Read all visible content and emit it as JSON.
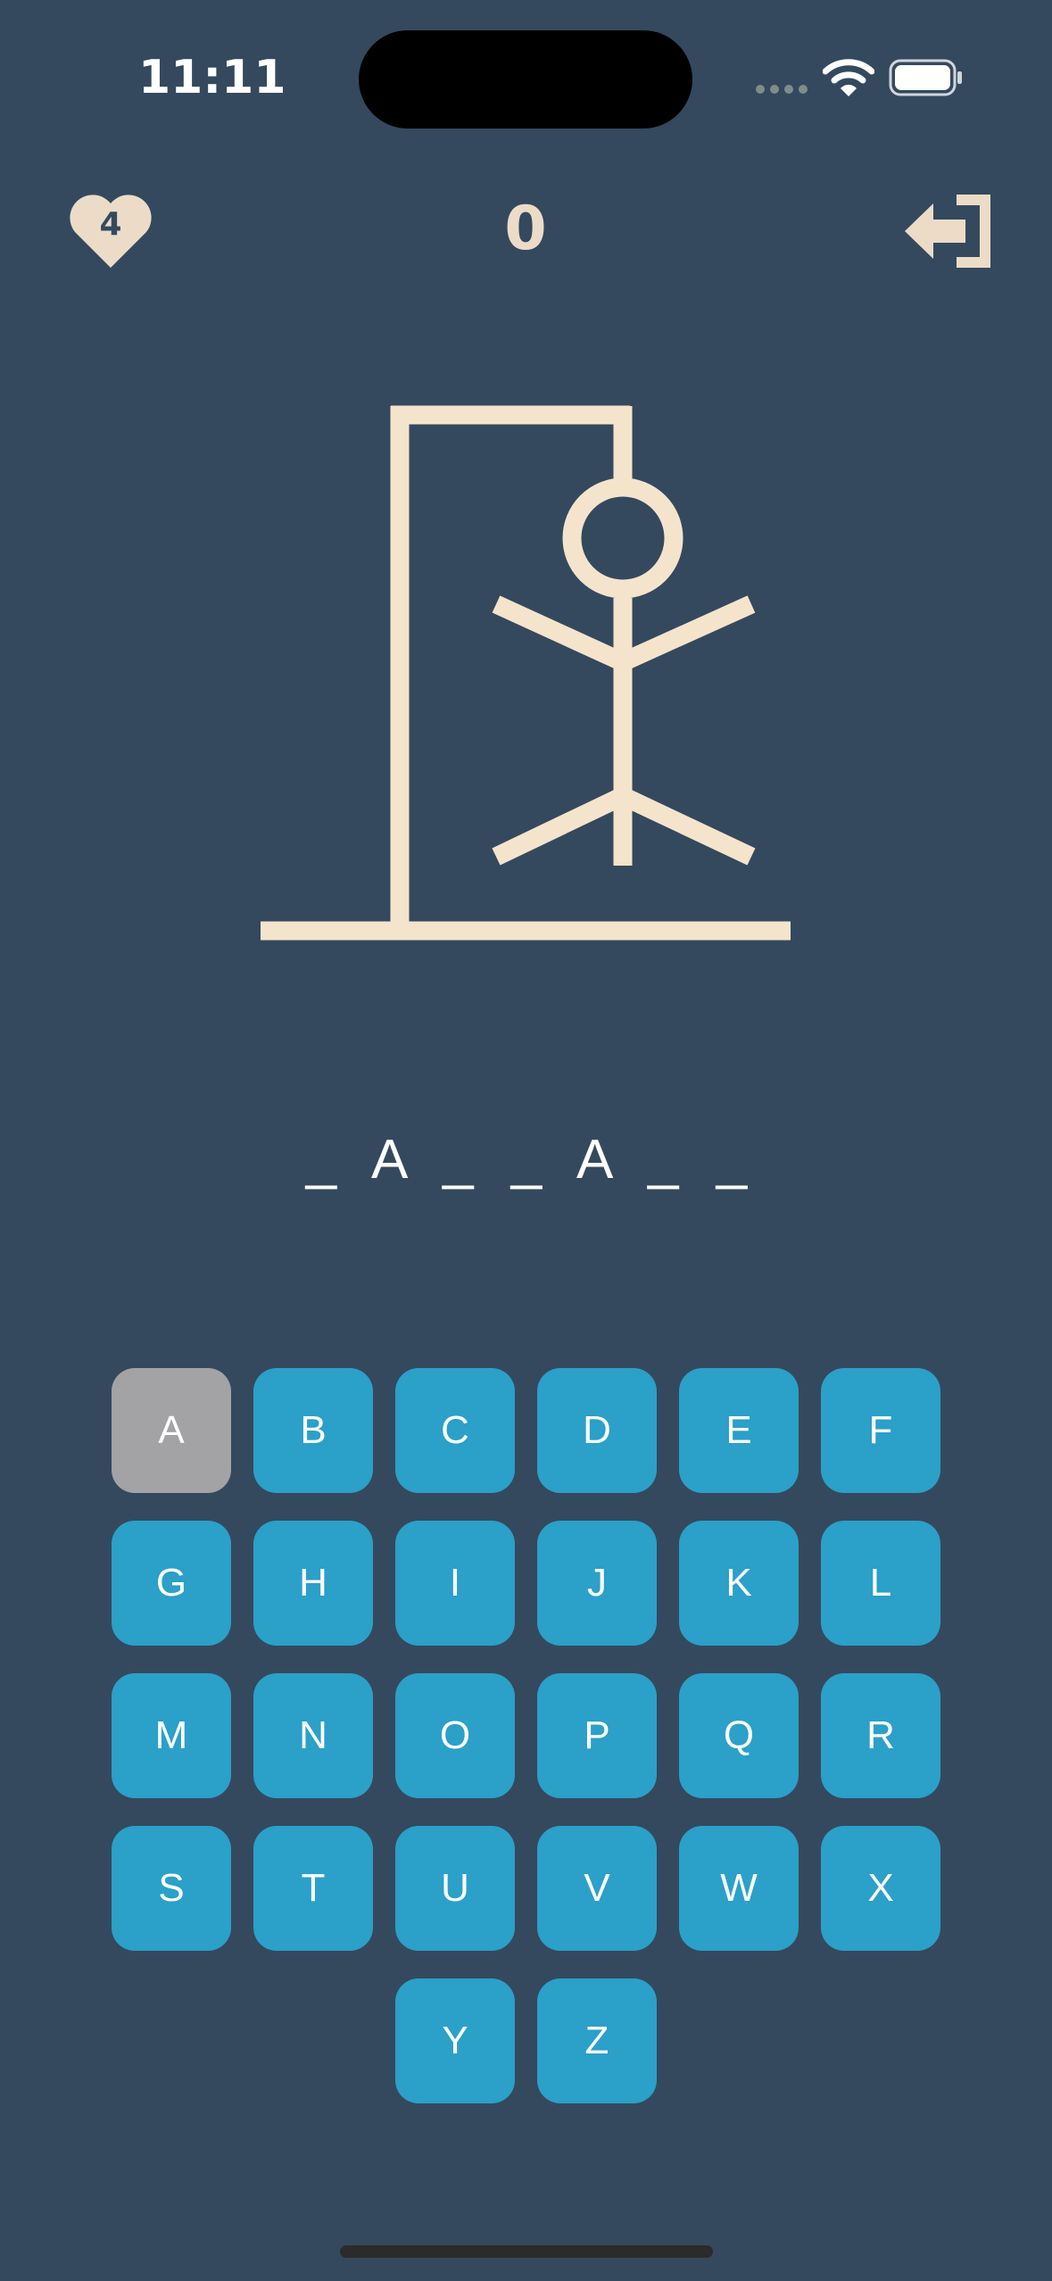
{
  "status_bar": {
    "time": "11:11"
  },
  "header": {
    "lives": "4",
    "score": "0",
    "lives_icon": "heart-icon",
    "exit_icon": "exit-icon"
  },
  "word": {
    "slots": [
      "_",
      "A",
      "_",
      "_",
      "A",
      "_",
      "_"
    ]
  },
  "keyboard": {
    "rows": [
      [
        "A",
        "B",
        "C",
        "D",
        "E",
        "F"
      ],
      [
        "G",
        "H",
        "I",
        "J",
        "K",
        "L"
      ],
      [
        "M",
        "N",
        "O",
        "P",
        "Q",
        "R"
      ],
      [
        "S",
        "T",
        "U",
        "V",
        "W",
        "X"
      ],
      [
        "Y",
        "Z"
      ]
    ],
    "used": [
      "A"
    ]
  },
  "colors": {
    "background": "#34495e",
    "key": "#2ba0c8",
    "key_used": "#a3a2a5",
    "drawing": "#f5e4cc",
    "text": "#ffffff"
  }
}
